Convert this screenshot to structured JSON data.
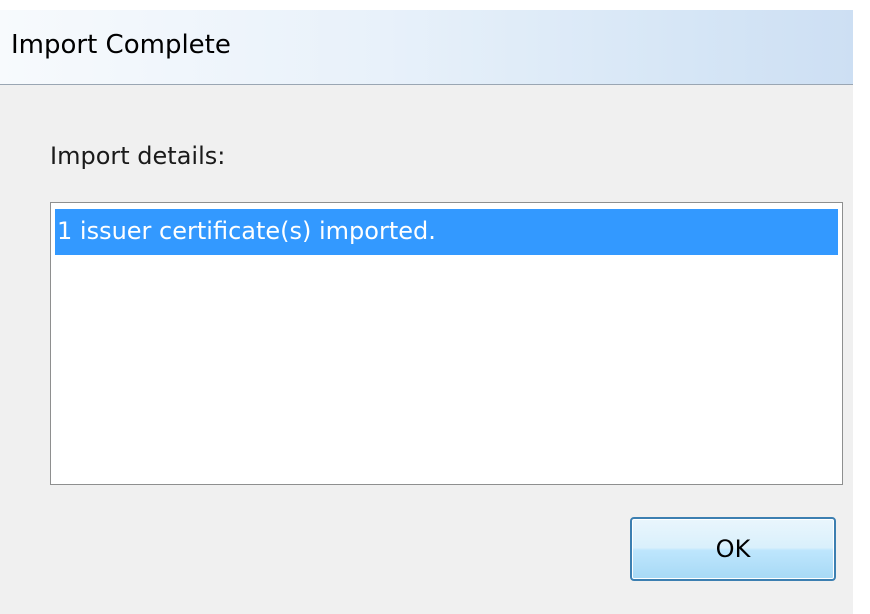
{
  "window": {
    "title": "Import Complete"
  },
  "details": {
    "label": "Import details:",
    "items": [
      "1 issuer certificate(s) imported."
    ],
    "selected_index": 0
  },
  "buttons": {
    "ok_label": "OK"
  },
  "colors": {
    "selection": "#3399ff",
    "dialog_background": "#f0f0f0",
    "button_border": "#3c7fb1"
  }
}
